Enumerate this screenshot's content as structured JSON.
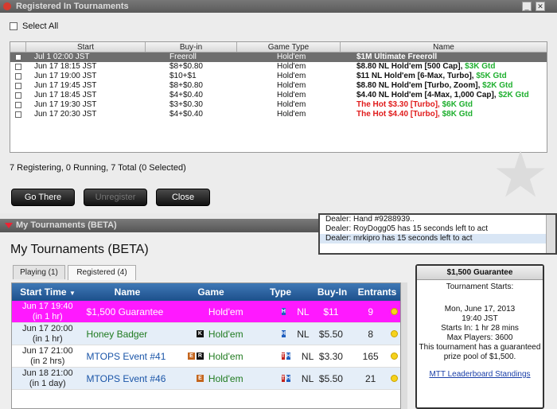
{
  "dialog": {
    "title": "Registered In Tournaments",
    "select_all": "Select All",
    "columns": [
      "Start",
      "Buy-in",
      "Game Type",
      "Name"
    ],
    "rows": [
      {
        "start": "Jul 1  02:00 JST",
        "buyin": "Freeroll",
        "game": "Hold'em",
        "name": "$1M Ultimate Freeroll",
        "name_extra": "",
        "red": false,
        "selected": true
      },
      {
        "start": "Jun 17  18:15 JST",
        "buyin": "$8+$0.80",
        "game": "Hold'em",
        "name": "$8.80 NL Hold'em [500 Cap], ",
        "name_extra": "$3K Gtd",
        "red": false,
        "selected": false
      },
      {
        "start": "Jun 17  19:00 JST",
        "buyin": "$10+$1",
        "game": "Hold'em",
        "name": "$11 NL Hold'em [6-Max, Turbo], ",
        "name_extra": "$5K Gtd",
        "red": false,
        "selected": false
      },
      {
        "start": "Jun 17  19:45 JST",
        "buyin": "$8+$0.80",
        "game": "Hold'em",
        "name": "$8.80 NL Hold'em [Turbo, Zoom], ",
        "name_extra": "$2K Gtd",
        "red": false,
        "selected": false
      },
      {
        "start": "Jun 17  18:45 JST",
        "buyin": "$4+$0.40",
        "game": "Hold'em",
        "name": "$4.40 NL Hold'em [4-Max, 1,000 Cap], ",
        "name_extra": "$2K Gtd",
        "red": false,
        "selected": false
      },
      {
        "start": "Jun 17  19:30 JST",
        "buyin": "$3+$0.30",
        "game": "Hold'em",
        "name": "The Hot $3.30 [Turbo], ",
        "name_extra": "$6K Gtd",
        "red": true,
        "selected": false
      },
      {
        "start": "Jun 17  20:30 JST",
        "buyin": "$4+$0.40",
        "game": "Hold'em",
        "name": "The Hot $4.40 [Turbo], ",
        "name_extra": "$8K Gtd",
        "red": true,
        "selected": false
      }
    ],
    "status": "7 Registering, 0 Running, 7 Total (0 Selected)",
    "buttons": {
      "go_there": "Go There",
      "unregister": "Unregister",
      "close": "Close"
    },
    "win_buttons": {
      "minimize": "_",
      "close": "✕"
    }
  },
  "chat": {
    "lines": [
      "Dealer: Hand #9288939..",
      "Dealer: RoyDogg05 has 15 seconds left to act",
      "Dealer: mrkipro has 15 seconds left to act"
    ]
  },
  "my_tournaments": {
    "bar_title": "My Tournaments (BETA)",
    "title": "My Tournaments (BETA)",
    "tabs": [
      "Playing (1)",
      "Registered (4)"
    ],
    "columns": [
      "Start Time",
      "Name",
      "Game",
      "Type",
      "Buy-In",
      "Entrants"
    ],
    "sort_indicator": "▼",
    "rows": [
      {
        "start1": "Jun 17 19:40",
        "start2": "(in 1 hr)",
        "name": "$1,500 Guarantee",
        "badges": [],
        "game": "Hold'em",
        "gicons": [
          "H"
        ],
        "type": "NL",
        "buyin": "$11",
        "entrants": "9"
      },
      {
        "start1": "Jun 17 20:00",
        "start2": "(in 1 hr)",
        "name": "Honey Badger",
        "badges": [
          "K"
        ],
        "game": "Hold'em",
        "gicons": [
          "H"
        ],
        "type": "NL",
        "buyin": "$5.50",
        "entrants": "8"
      },
      {
        "start1": "Jun 17 21:00",
        "start2": "(in 2 hrs)",
        "name": "MTOPS Event #41",
        "badges": [
          "E",
          "R"
        ],
        "game": "Hold'em",
        "gicons": [
          "T",
          "H"
        ],
        "type": "NL",
        "buyin": "$3.30",
        "entrants": "165"
      },
      {
        "start1": "Jun 18 21:00",
        "start2": "(in 1 day)",
        "name": "MTOPS Event #46",
        "badges": [
          "E"
        ],
        "game": "Hold'em",
        "gicons": [
          "T",
          "H"
        ],
        "type": "NL",
        "buyin": "$5.50",
        "entrants": "21"
      }
    ]
  },
  "info_panel": {
    "title": "$1,500 Guarantee",
    "starts_label": "Tournament Starts:",
    "date": "Mon, June 17, 2013",
    "time": "19:40 JST",
    "starts_in": "Starts In: 1 hr 28 mins",
    "max_players": "Max Players: 3600",
    "desc1": "This tournament has a guaranteed",
    "desc2": "prize pool of $1,500.",
    "link": "MTT Leaderboard Standings"
  },
  "colors": {
    "highlight_row": "#ff19ff",
    "header_blue": "#1d4f8c",
    "gtd_green": "#20b030",
    "hot_red": "#e01b1b"
  }
}
